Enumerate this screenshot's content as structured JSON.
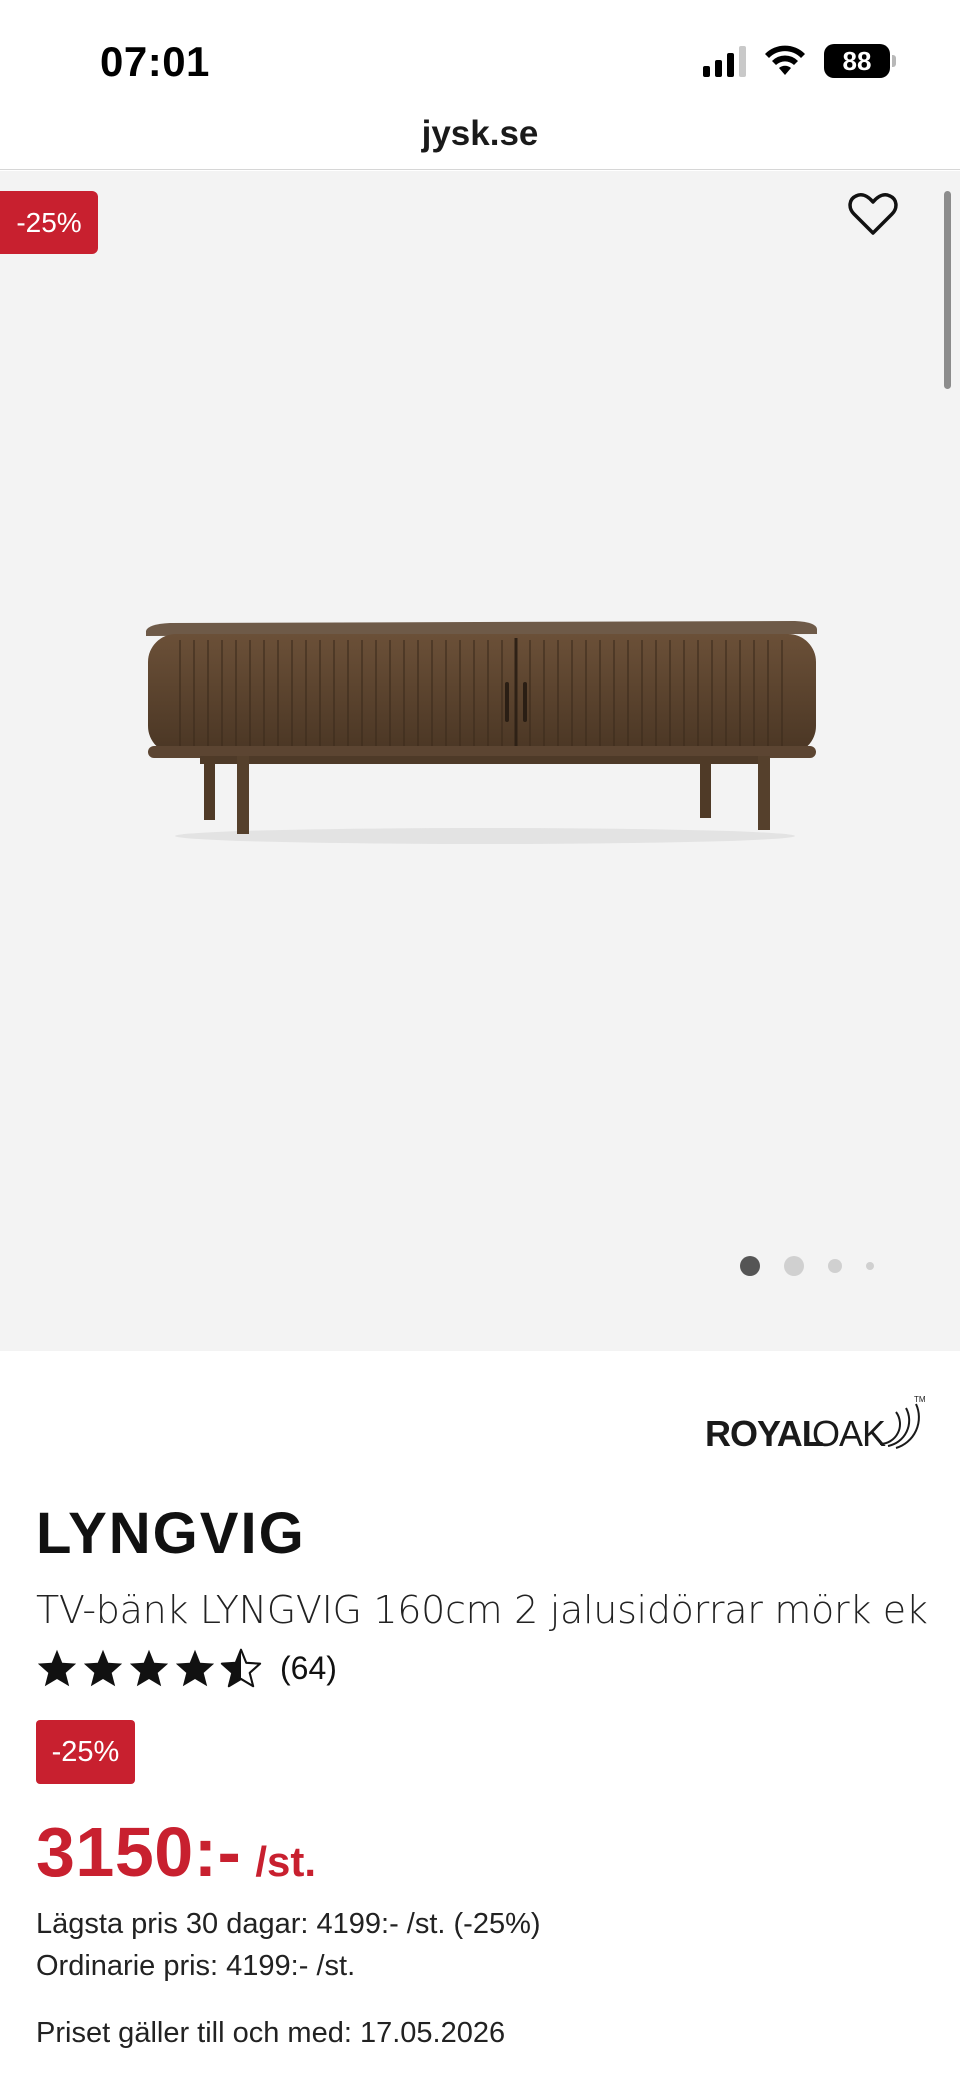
{
  "status_bar": {
    "time": "07:01",
    "battery": "88"
  },
  "browser": {
    "url": "jysk.se"
  },
  "gallery": {
    "discount_badge": "-25%",
    "favorite_icon": "heart-outline-icon",
    "image_count": 4,
    "active_image": 1
  },
  "brand": {
    "logo_text": "ROYAL OAK"
  },
  "product": {
    "name": "LYNGVIG",
    "description": "TV-bänk LYNGVIG 160cm 2 jalusidörrar mörk ek",
    "rating": 4.5,
    "rating_max": 5,
    "review_count": "(64)",
    "discount_badge": "-25%",
    "price": "3150:-",
    "price_unit": "/st.",
    "lowest_price_30_days": "Lägsta pris 30 dagar: 4199:- /st. (-25%)",
    "ordinary_price": "Ordinarie pris: 4199:- /st.",
    "valid_until": "Priset gäller till och med: 17.05.2026"
  },
  "colors": {
    "accent_red": "#c8202f",
    "gallery_bg": "#f3f3f3",
    "wood": "#5a4330"
  }
}
